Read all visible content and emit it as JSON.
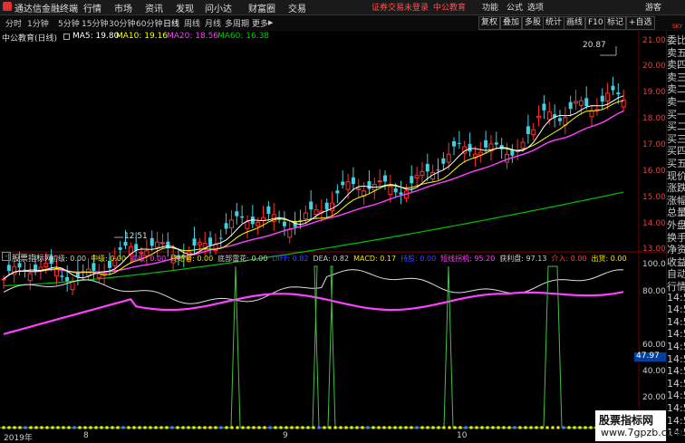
{
  "app": {
    "title": "通达信金融终端"
  },
  "menu": [
    "行情",
    "市场",
    "资讯",
    "发现",
    "问小达",
    "财富圈",
    "交易"
  ],
  "warning": "证券交易未登录",
  "stock_name_top": "中公教育",
  "right_menu": [
    "功能",
    "公式",
    "选项",
    "游客"
  ],
  "periods": [
    "分时",
    "1分钟",
    "5分钟",
    "15分钟",
    "30分钟",
    "60分钟",
    "日线",
    "周线",
    "月线",
    "多周期",
    "更多"
  ],
  "active_period": "日线",
  "toolbar": [
    "复权",
    "叠加",
    "多股",
    "统计",
    "画线",
    "F10",
    "标记",
    "+自选"
  ],
  "ma_info": {
    "stock": "中公教育(日线)",
    "ma5": "MA5: 19.80",
    "ma10": "MA10: 19.16",
    "ma20": "MA20: 18.56",
    "ma60": "MA60: 16.38"
  },
  "price_axis": [
    "21.00",
    "20.00",
    "19.00",
    "18.00",
    "17.00",
    "16.00",
    "15.00",
    "14.00",
    "13.00"
  ],
  "annotations": {
    "high": "20.87",
    "low": "12.51"
  },
  "indicator": {
    "name": "股票指标网",
    "items": [
      {
        "label": "初级: 0.00",
        "color": "#cccccc"
      },
      {
        "label": "中级: 0.00",
        "color": "#e8e800"
      },
      {
        "label": "高级: 0.00",
        "color": "#ff40ff"
      },
      {
        "label": "终结者: 0.00",
        "color": "#e8e800"
      },
      {
        "label": "底部雷花: 0.00",
        "color": "#cccccc"
      },
      {
        "label": "DIFF: 0.82",
        "color": "#4040ff"
      },
      {
        "label": "DEA: 0.82",
        "color": "#cccccc"
      },
      {
        "label": "MACD: 0.17",
        "color": "#e8e800"
      },
      {
        "label": "持股: 0.00",
        "color": "#4040ff"
      },
      {
        "label": "短线拐机: 95.20",
        "color": "#ff40ff"
      },
      {
        "label": "获利盘: 97.13",
        "color": "#cccccc"
      },
      {
        "label": "介入: 0.00",
        "color": "#ff4040"
      },
      {
        "label": "出货: 0.00",
        "color": "#e8e800"
      }
    ]
  },
  "indicator_axis": [
    "100.00",
    "80.00",
    "60.00",
    "40.00",
    "20.00"
  ],
  "indicator_marker": "47.97",
  "date_labels": [
    "2019年",
    "8",
    "9",
    "10"
  ],
  "sidebar": [
    "委比",
    "卖五",
    "卖四",
    "卖三",
    "卖二",
    "卖一",
    "买一",
    "买二",
    "买三",
    "买四",
    "买五",
    "现价",
    "涨跌",
    "涨幅",
    "总量",
    "外盘",
    "换手",
    "净资",
    "收益",
    "自动",
    "行情",
    "14:5",
    "14:5",
    "14:5",
    "14:5",
    "14:5",
    "14:5",
    "14:5",
    "14:5",
    "14:5",
    "14:5",
    "14:5",
    "14:5"
  ],
  "sidebar_tag": "SKY",
  "watermark": {
    "line1": "股票指标网",
    "line2": "www.7gpzb.com"
  },
  "colors": {
    "up": "#ff3030",
    "down": "#40d0e0",
    "ma5": "#ffffff",
    "ma10": "#ffff00",
    "ma20": "#ff40ff",
    "ma60": "#00c000"
  }
}
